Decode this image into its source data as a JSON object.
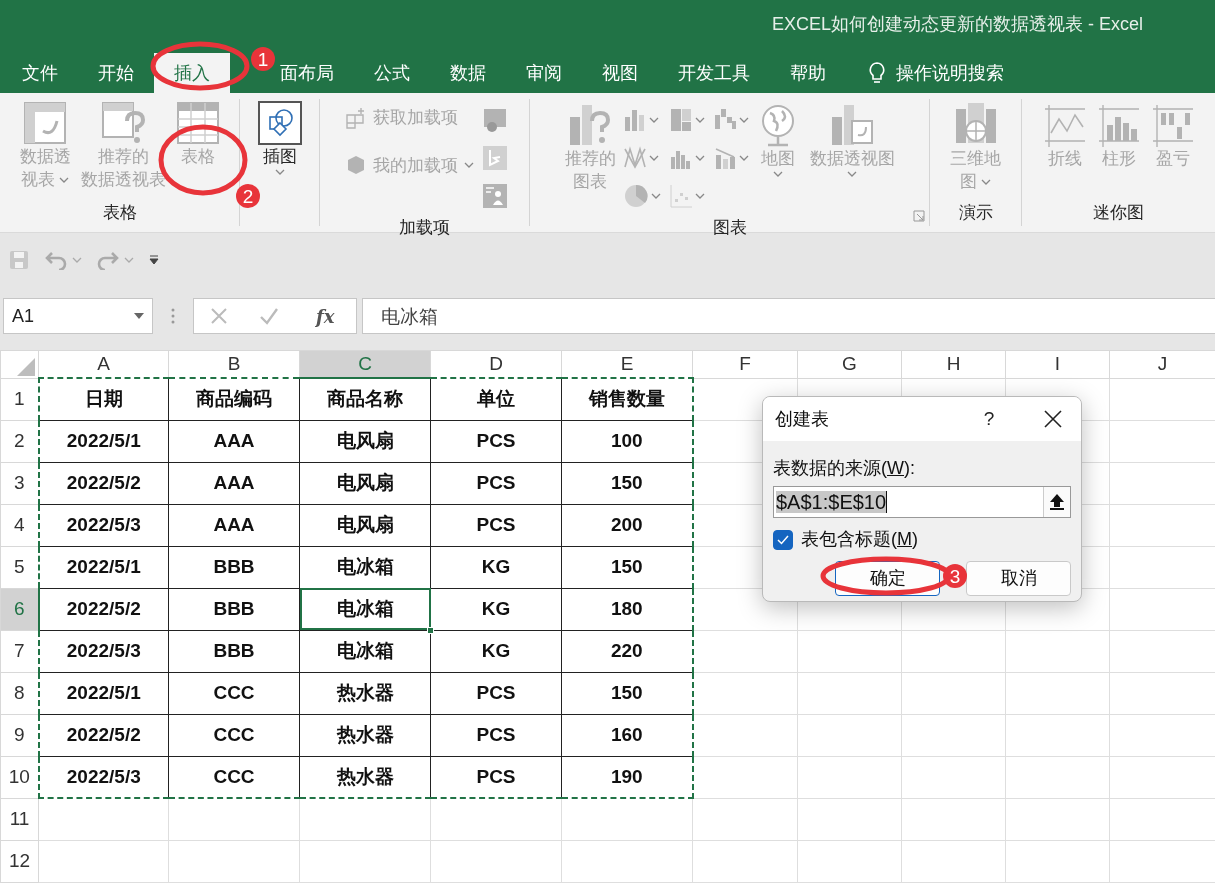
{
  "window": {
    "title": "EXCEL如何创建动态更新的数据透视表 - Excel"
  },
  "tabs": [
    {
      "label": "文件",
      "selected": false
    },
    {
      "label": "开始",
      "selected": false
    },
    {
      "label": "插入",
      "selected": true
    },
    {
      "label": "面布局",
      "selected": false
    },
    {
      "label": "公式",
      "selected": false
    },
    {
      "label": "数据",
      "selected": false
    },
    {
      "label": "审阅",
      "selected": false
    },
    {
      "label": "视图",
      "selected": false
    },
    {
      "label": "开发工具",
      "selected": false
    },
    {
      "label": "帮助",
      "selected": false
    }
  ],
  "tell_me": {
    "label": "操作说明搜索"
  },
  "ribbon": {
    "groups": [
      {
        "label": "表格",
        "items": [
          {
            "kind": "large",
            "lines": [
              "数据透",
              "视表"
            ],
            "dropdown": true,
            "disabled": true
          },
          {
            "kind": "large",
            "lines": [
              "推荐的",
              "数据透视表"
            ],
            "dropdown": false,
            "disabled": true
          },
          {
            "kind": "large",
            "lines": [
              "表格"
            ],
            "dropdown": false,
            "disabled": true
          }
        ]
      },
      {
        "items": [
          {
            "kind": "large",
            "lines": [
              "插图"
            ],
            "dropdown": true,
            "disabled": false
          }
        ]
      },
      {
        "label": "加载项",
        "items": [
          {
            "kind": "small",
            "lines": [
              "获取加载项"
            ],
            "dropdown": false,
            "disabled": true
          },
          {
            "kind": "small",
            "lines": [
              "我的加载项"
            ],
            "dropdown": true,
            "disabled": true
          },
          {
            "kind": "icon",
            "dropdown": false,
            "disabled": true
          },
          {
            "kind": "icon",
            "dropdown": false,
            "disabled": true
          },
          {
            "kind": "icon",
            "dropdown": false,
            "disabled": true
          }
        ]
      },
      {
        "label": "图表",
        "launcher": true,
        "items": [
          {
            "kind": "large",
            "lines": [
              "推荐的",
              "图表"
            ],
            "dropdown": false,
            "disabled": true
          },
          {
            "kind": "icon",
            "dropdown": true,
            "disabled": true
          },
          {
            "kind": "icon",
            "dropdown": true,
            "disabled": true
          },
          {
            "kind": "icon",
            "dropdown": true,
            "disabled": true
          },
          {
            "kind": "icon",
            "dropdown": true,
            "disabled": true
          },
          {
            "kind": "icon",
            "dropdown": true,
            "disabled": true
          },
          {
            "kind": "icon",
            "dropdown": true,
            "disabled": true
          },
          {
            "kind": "icon",
            "dropdown": true,
            "disabled": true
          },
          {
            "kind": "icon",
            "dropdown": true,
            "disabled": true
          },
          {
            "kind": "large",
            "lines": [
              "地图"
            ],
            "dropdown": true,
            "disabled": true
          },
          {
            "kind": "large",
            "lines": [
              "数据透视图"
            ],
            "dropdown": true,
            "disabled": true
          }
        ]
      },
      {
        "label": "演示",
        "items": [
          {
            "kind": "large",
            "lines": [
              "三维地",
              "图"
            ],
            "dropdown": true,
            "disabled": true
          }
        ]
      },
      {
        "label": "迷你图",
        "items": [
          {
            "kind": "large",
            "lines": [
              "折线"
            ],
            "dropdown": false,
            "disabled": true
          },
          {
            "kind": "large",
            "lines": [
              "柱形"
            ],
            "dropdown": false,
            "disabled": true
          },
          {
            "kind": "large",
            "lines": [
              "盈亏"
            ],
            "dropdown": false,
            "disabled": true
          }
        ]
      }
    ]
  },
  "formula_bar": {
    "name_box": "A1",
    "fx": "fx",
    "value": "电冰箱"
  },
  "sheet": {
    "copy_marquee": true,
    "columns": [
      {
        "label": "A",
        "selected": false
      },
      {
        "label": "B",
        "selected": false
      },
      {
        "label": "C",
        "selected": true
      },
      {
        "label": "D",
        "selected": false
      },
      {
        "label": "E",
        "selected": false
      },
      {
        "label": "F",
        "selected": false
      },
      {
        "label": "G",
        "selected": false
      },
      {
        "label": "H",
        "selected": false
      },
      {
        "label": "I",
        "selected": false
      },
      {
        "label": "J",
        "selected": false
      }
    ],
    "rows": [
      {
        "label": "1",
        "selected": false,
        "cells": [
          "日期",
          "商品编码",
          "商品名称",
          "单位",
          "销售数量"
        ]
      },
      {
        "label": "2",
        "selected": false,
        "cells": [
          "2022/5/1",
          "AAA",
          "电风扇",
          "PCS",
          "100"
        ]
      },
      {
        "label": "3",
        "selected": false,
        "cells": [
          "2022/5/2",
          "AAA",
          "电风扇",
          "PCS",
          "150"
        ]
      },
      {
        "label": "4",
        "selected": false,
        "cells": [
          "2022/5/3",
          "AAA",
          "电风扇",
          "PCS",
          "200"
        ]
      },
      {
        "label": "5",
        "selected": false,
        "cells": [
          "2022/5/1",
          "BBB",
          "电冰箱",
          "KG",
          "150"
        ]
      },
      {
        "label": "6",
        "selected": true,
        "cells": [
          "2022/5/2",
          "BBB",
          "电冰箱",
          "KG",
          "180"
        ]
      },
      {
        "label": "7",
        "selected": false,
        "cells": [
          "2022/5/3",
          "BBB",
          "电冰箱",
          "KG",
          "220"
        ]
      },
      {
        "label": "8",
        "selected": false,
        "cells": [
          "2022/5/1",
          "CCC",
          "热水器",
          "PCS",
          "150"
        ]
      },
      {
        "label": "9",
        "selected": false,
        "cells": [
          "2022/5/2",
          "CCC",
          "热水器",
          "PCS",
          "160"
        ]
      },
      {
        "label": "10",
        "selected": false,
        "cells": [
          "2022/5/3",
          "CCC",
          "热水器",
          "PCS",
          "190"
        ]
      },
      {
        "label": "11",
        "selected": false,
        "cells": []
      },
      {
        "label": "12",
        "selected": false,
        "cells": []
      }
    ]
  },
  "dialog": {
    "title": "创建表",
    "help": "?",
    "source_label": [
      "表数据的来源(",
      "W",
      "):"
    ],
    "range": "$A$1:$E$10",
    "range_selected": true,
    "header_checkbox": {
      "label": [
        "表包含标题(",
        "M",
        ")"
      ],
      "checked": true
    },
    "buttons": [
      {
        "label": "确定",
        "default": true
      },
      {
        "label": "取消",
        "default": false
      }
    ]
  },
  "annotations": [
    {
      "number": "1"
    },
    {
      "number": "2"
    },
    {
      "number": "3"
    }
  ]
}
